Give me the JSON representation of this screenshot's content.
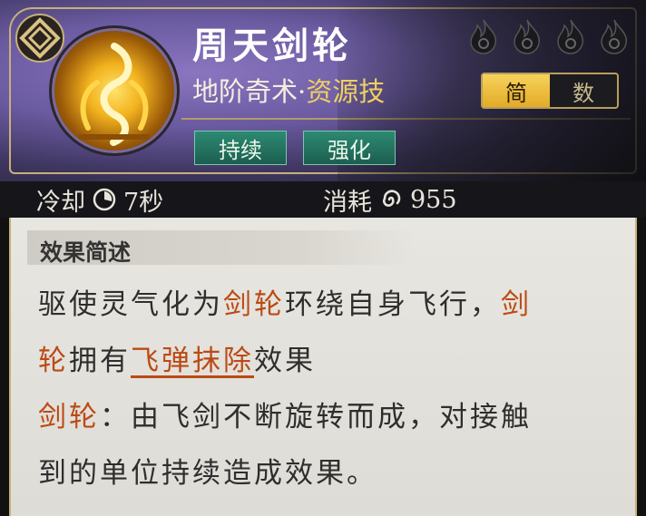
{
  "skill": {
    "name": "周天剑轮",
    "category": "地阶奇术",
    "separator": "·",
    "type": "资源技",
    "rank_flames": 4,
    "icon": "golden-sword-ring-icon"
  },
  "view_toggle": {
    "simple_label": "简",
    "numbers_label": "数",
    "selected": "简"
  },
  "tags": [
    "持续",
    "强化"
  ],
  "stats": {
    "cooldown_label": "冷却",
    "cooldown_value": "7秒",
    "cost_label": "消耗",
    "cost_value": "955"
  },
  "effect": {
    "section_title": "效果简述",
    "line1": {
      "a": "驱使灵气化为",
      "kw1": "剑轮",
      "b": "环绕自身飞行，",
      "kw2a": "剑"
    },
    "line2": {
      "kw2b": "轮",
      "a": "拥有",
      "link": "飞弹抹除",
      "b": "效果"
    },
    "line3": {
      "kw": "剑轮",
      "a": "：由飞剑不断旋转而成，对接触"
    },
    "line4": {
      "a": "到的单位持续造成效果。"
    }
  },
  "colors": {
    "keyword": "#bb4a16",
    "tag_bg": "#1c5e50",
    "toggle_active": "#f0c040",
    "gold_frame": "#c7b07a"
  }
}
